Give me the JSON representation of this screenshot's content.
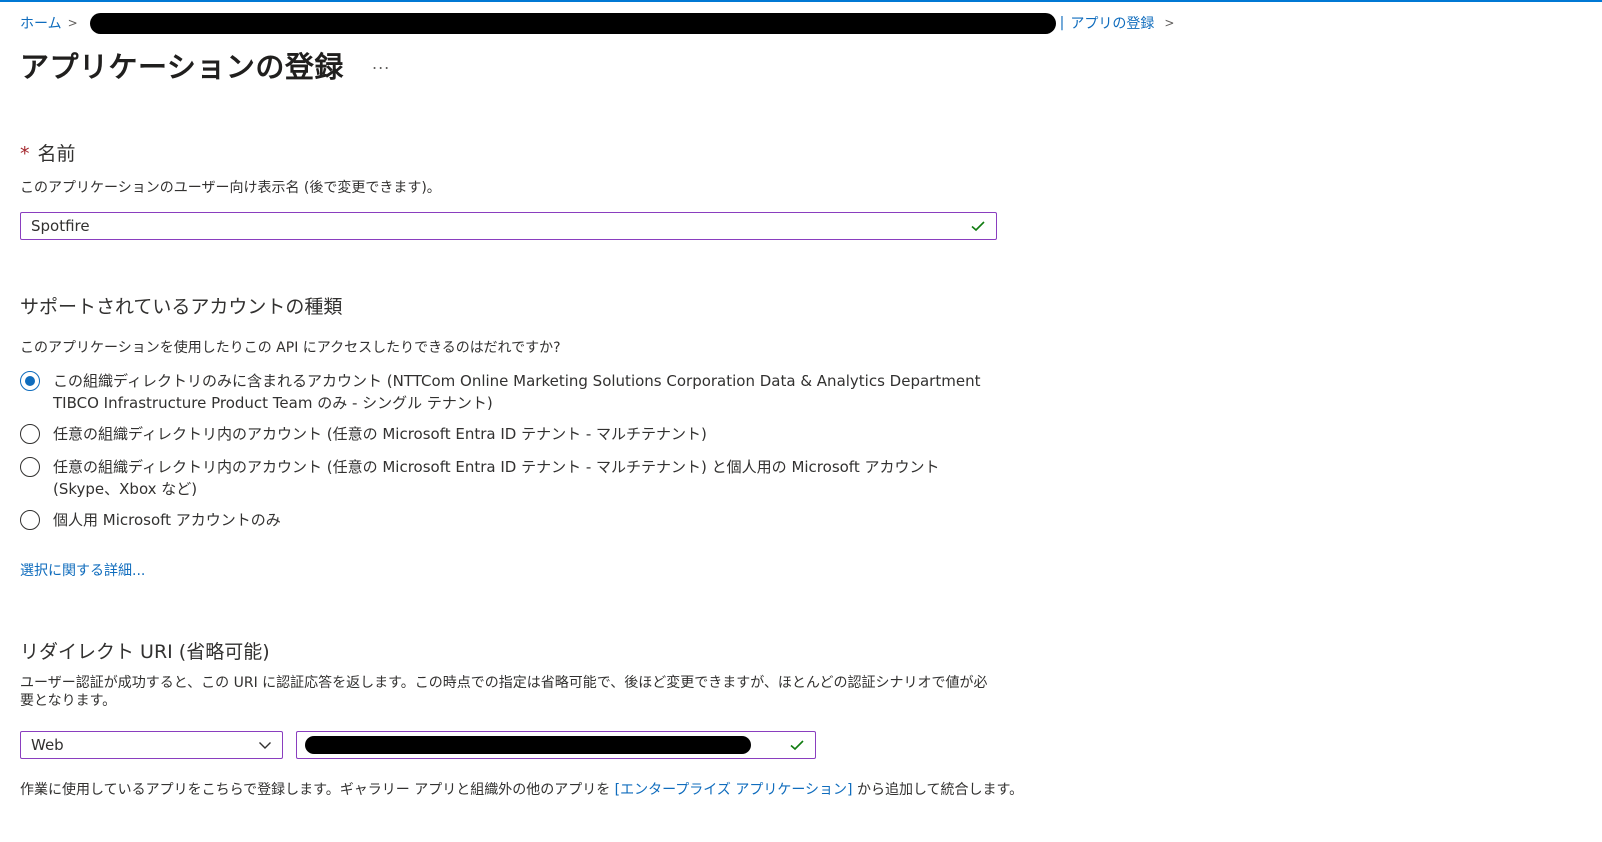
{
  "breadcrumb": {
    "home": "ホーム",
    "current": "アプリの登録"
  },
  "page": {
    "title": "アプリケーションの登録",
    "more": "..."
  },
  "name_field": {
    "required_mark": "*",
    "label": "名前",
    "description": "このアプリケーションのユーザー向け表示名 (後で変更できます)。",
    "value": "Spotfire"
  },
  "account_types": {
    "heading": "サポートされているアカウントの種類",
    "question": "このアプリケーションを使用したりこの API にアクセスしたりできるのはだれですか?",
    "options": [
      {
        "label": "この組織ディレクトリのみに含まれるアカウント (NTTCom Online Marketing Solutions Corporation Data & Analytics Department TIBCO Infrastructure Product Team のみ - シングル テナント)",
        "selected": true
      },
      {
        "label": "任意の組織ディレクトリ内のアカウント (任意の Microsoft Entra ID テナント - マルチテナント)",
        "selected": false
      },
      {
        "label": "任意の組織ディレクトリ内のアカウント (任意の Microsoft Entra ID テナント - マルチテナント) と個人用の Microsoft アカウント (Skype、Xbox など)",
        "selected": false
      },
      {
        "label": "個人用 Microsoft アカウントのみ",
        "selected": false
      }
    ],
    "help_link": "選択に関する詳細..."
  },
  "redirect": {
    "heading": "リダイレクト URI (省略可能)",
    "description": "ユーザー認証が成功すると、この URI に認証応答を返します。この時点での指定は省略可能で、後ほど変更できますが、ほとんどの認証シナリオで値が必要となります。",
    "platform_value": "Web"
  },
  "footer": {
    "text_before": "作業に使用しているアプリをこちらで登録します。ギャラリー アプリと組織外の他のアプリを ",
    "link": "[エンタープライズ アプリケーション]",
    "text_after": " から追加して統合します。"
  },
  "colors": {
    "accent": "#0f6cbd",
    "input_border": "#8a3ebf",
    "check_green": "#107c10",
    "required_red": "#a4262c"
  }
}
